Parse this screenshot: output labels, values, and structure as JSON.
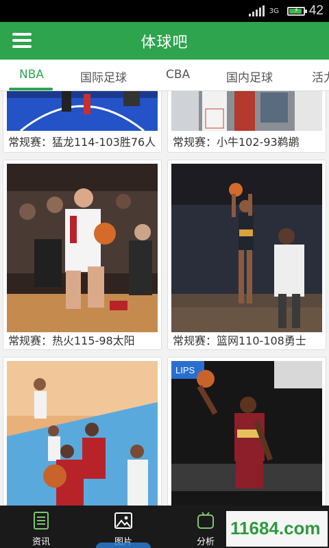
{
  "status_bar": {
    "network": "3G",
    "time": "42"
  },
  "app_bar": {
    "title": "体球吧",
    "menu_icon": "hamburger-menu-icon"
  },
  "tabs": [
    {
      "label": "NBA",
      "active": true
    },
    {
      "label": "国际足球",
      "active": false
    },
    {
      "label": "CBA",
      "active": false
    },
    {
      "label": "国内足球",
      "active": false
    },
    {
      "label": "活力",
      "active": false
    }
  ],
  "cards": [
    {
      "caption": "常规赛：猛龙114-103胜76人"
    },
    {
      "caption": "常规赛：小牛102-93鹈鹕"
    },
    {
      "caption": "常规赛：热火115-98太阳"
    },
    {
      "caption": "常规赛：篮网110-108勇士"
    },
    {
      "caption": ""
    },
    {
      "caption": ""
    }
  ],
  "bottom_nav": [
    {
      "label": "资讯",
      "icon": "news-document-icon",
      "active": false
    },
    {
      "label": "图片",
      "icon": "picture-icon",
      "active": true
    },
    {
      "label": "分析",
      "icon": "analysis-tv-icon",
      "active": false
    }
  ],
  "watermark": "11684.com",
  "colors": {
    "brand_green": "#2ea44f",
    "nav_highlight": "#2b7fd8"
  }
}
